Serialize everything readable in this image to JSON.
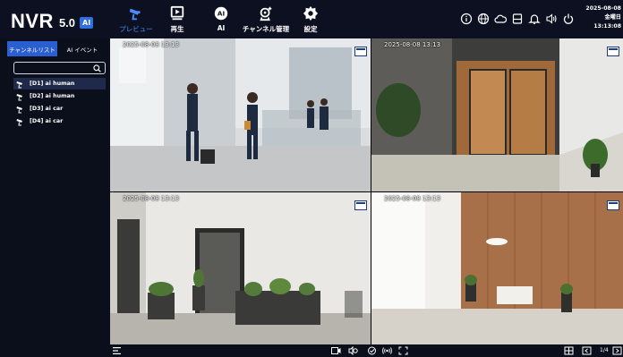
{
  "header": {
    "logo": {
      "brand": "NVR",
      "version": "5.0",
      "badge": "AI"
    },
    "nav": [
      {
        "label": "プレビュー",
        "icon": "camera-icon",
        "active": true
      },
      {
        "label": "再生",
        "icon": "playback-icon",
        "active": false
      },
      {
        "label": "AI",
        "icon": "ai-icon",
        "active": false
      },
      {
        "label": "チャンネル管理",
        "icon": "add-camera-icon",
        "active": false
      },
      {
        "label": "設定",
        "icon": "gear-icon",
        "active": false
      }
    ],
    "status_icons": [
      "info-icon",
      "globe-icon",
      "cloud-icon",
      "storage-icon",
      "bell-icon",
      "volume-icon",
      "power-icon"
    ],
    "date": "2025-08-08",
    "weekday": "金曜日",
    "time": "13:13:08"
  },
  "sidebar": {
    "tabs": [
      {
        "label": "チャンネルリスト",
        "active": true
      },
      {
        "label": "AI イベント",
        "active": false
      }
    ],
    "search": {
      "placeholder": "",
      "value": ""
    },
    "channels": [
      {
        "label": "[D1] ai human",
        "selected": true
      },
      {
        "label": "[D2] ai human",
        "selected": false
      },
      {
        "label": "[D3] ai car",
        "selected": false
      },
      {
        "label": "[D4] ai car",
        "selected": false
      }
    ]
  },
  "tiles": [
    {
      "timestamp": "2025-08-08  13:13"
    },
    {
      "timestamp": "2025-08-08  13:13"
    },
    {
      "timestamp": "2025-08-08  13:13"
    },
    {
      "timestamp": "2025-08-08  13:13"
    }
  ],
  "bottom_bar": {
    "icons": [
      "menu-icon",
      "record-icon",
      "talk-icon",
      "capture-icon",
      "wireless-icon",
      "fullscreen-icon",
      "layout-icon",
      "prev-page-icon",
      "next-page-icon"
    ],
    "page": "1/4"
  },
  "colors": {
    "accent": "#2b5fd1",
    "active_nav": "#4a8cff",
    "background": "#0b0f1c",
    "selected_row": "#1f2a4a"
  }
}
